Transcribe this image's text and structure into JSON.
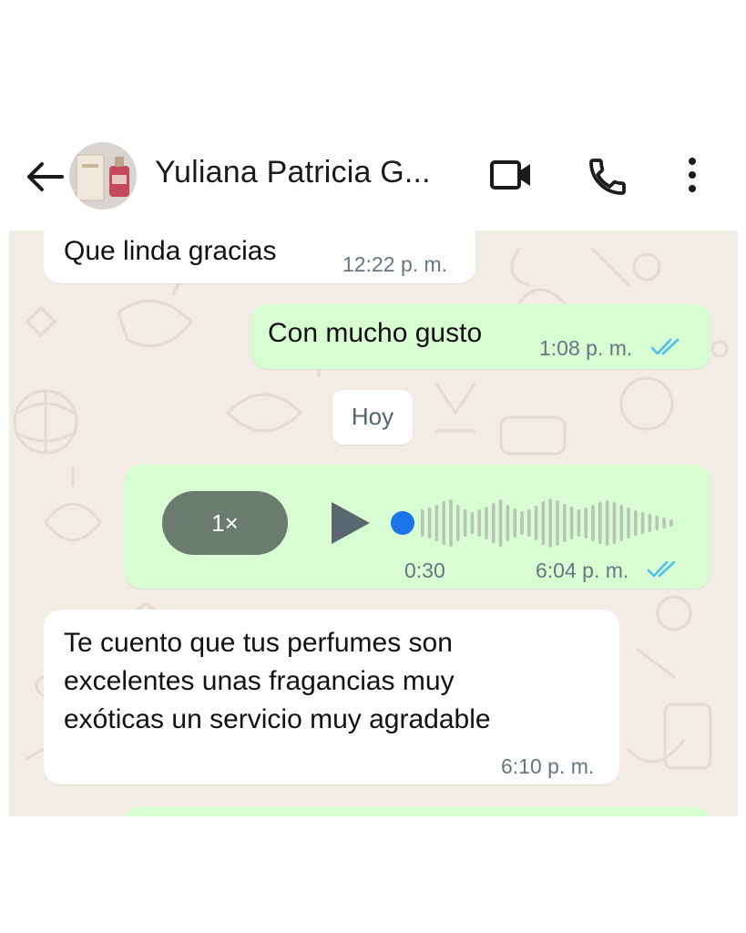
{
  "header": {
    "contact_name": "Yuliana Patricia G...",
    "back_icon": "arrow-left-icon",
    "video_icon": "video-camera-icon",
    "call_icon": "phone-icon",
    "menu_icon": "vertical-dots-icon"
  },
  "messages": [
    {
      "direction": "incoming",
      "text": "Que linda gracias",
      "time": "12:22 p. m."
    },
    {
      "direction": "outgoing",
      "text": "Con mucho gusto",
      "time": "1:08 p. m.",
      "status": "read"
    },
    {
      "direction": "outgoing",
      "type": "voice",
      "speed": "1×",
      "duration": "0:30",
      "time": "6:04 p. m.",
      "status": "read",
      "progress": 0
    },
    {
      "direction": "incoming",
      "lines": [
        "Te cuento que tus perfumes son",
        "excelentes unas fragancias muy",
        "exóticas un servicio muy agradable"
      ],
      "time": "6:10 p. m."
    }
  ],
  "date_separator": "Hoy",
  "colors": {
    "incoming_bubble": "#ffffff",
    "outgoing_bubble": "#d9fdd3",
    "read_ticks": "#53bdeb",
    "wallpaper": "#f1ece4",
    "voice_dot": "#1a73e8",
    "speed_pill": "#6b7c6e"
  }
}
